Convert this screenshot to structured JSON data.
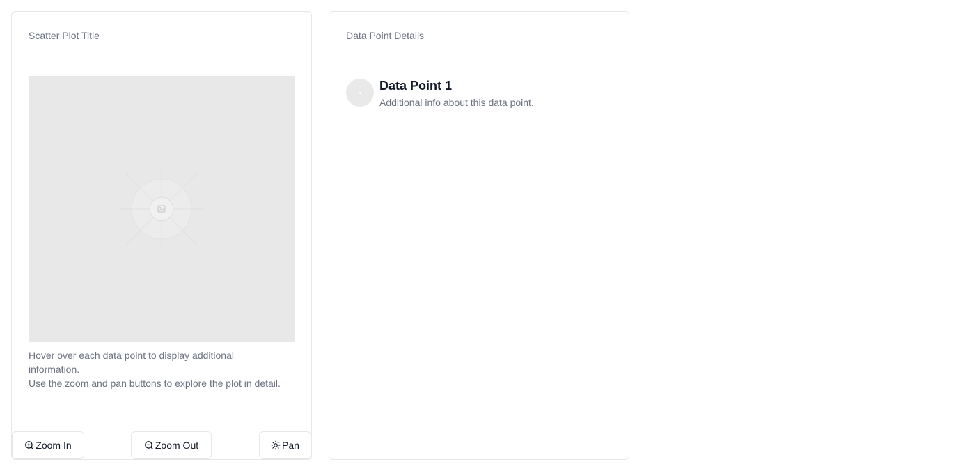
{
  "plot_card": {
    "title": "Scatter Plot Title",
    "description_line1": "Hover over each data point to display additional information.",
    "description_line2": "Use the zoom and pan buttons to explore the plot in detail.",
    "placeholder_icon": "image-placeholder-icon",
    "buttons": {
      "zoom_in": {
        "label": "Zoom In",
        "icon": "zoom-in-icon"
      },
      "zoom_out": {
        "label": "Zoom Out",
        "icon": "zoom-out-icon"
      },
      "pan": {
        "label": "Pan",
        "icon": "sun-icon"
      }
    }
  },
  "details_card": {
    "title": "Data Point Details",
    "point": {
      "name": "Data Point 1",
      "info": "Additional info about this data point.",
      "avatar_icon": "avatar-placeholder"
    }
  },
  "colors": {
    "border": "#e5e7eb",
    "muted_text": "#6b7280",
    "text": "#111827",
    "placeholder_bg": "#e8e8e8"
  }
}
